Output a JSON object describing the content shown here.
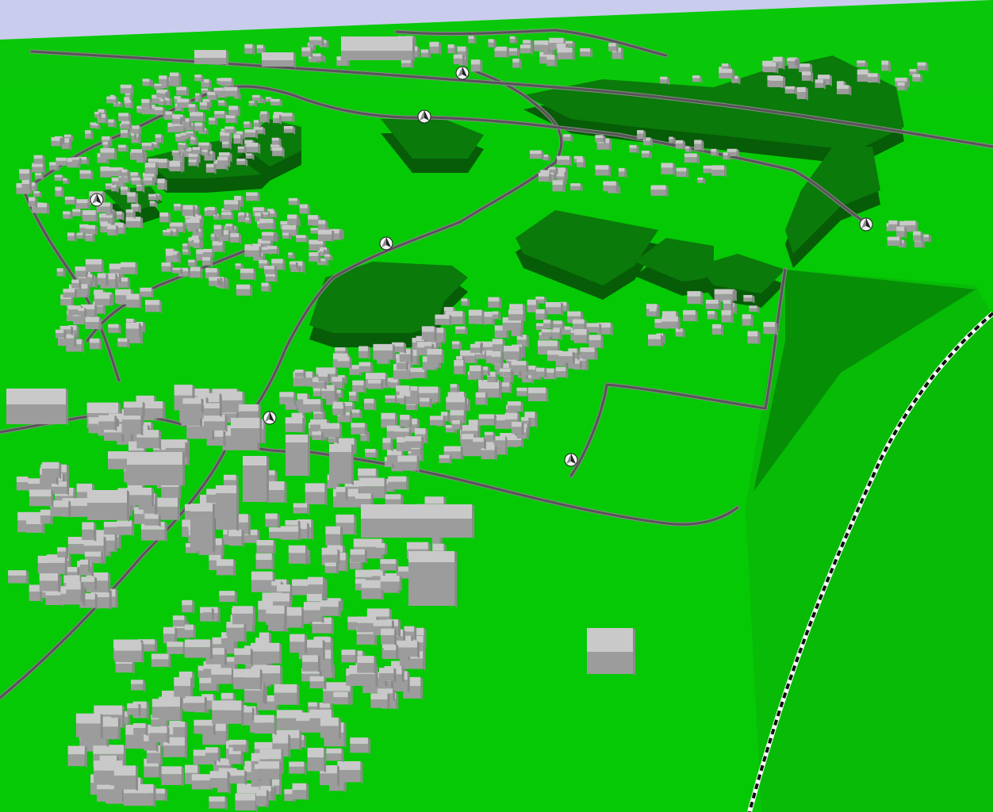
{
  "scene": {
    "kind": "3d-city-terrain-view",
    "colors": {
      "sky": "#c9ccec",
      "terrain": "#05c905",
      "terrain_far": "#07c407",
      "forest_top": "#0a7a0a",
      "forest_side": "#075c07",
      "building_top": "#c9c9c9",
      "building_side": "#9c9c9c",
      "road": "#555555",
      "railway": "#ffffff",
      "railway_dash": "#111111"
    },
    "icons": [
      "tree-marker-icon"
    ],
    "building_count_approx": 900,
    "forest_patch_count": 9,
    "marker_count": 7
  }
}
